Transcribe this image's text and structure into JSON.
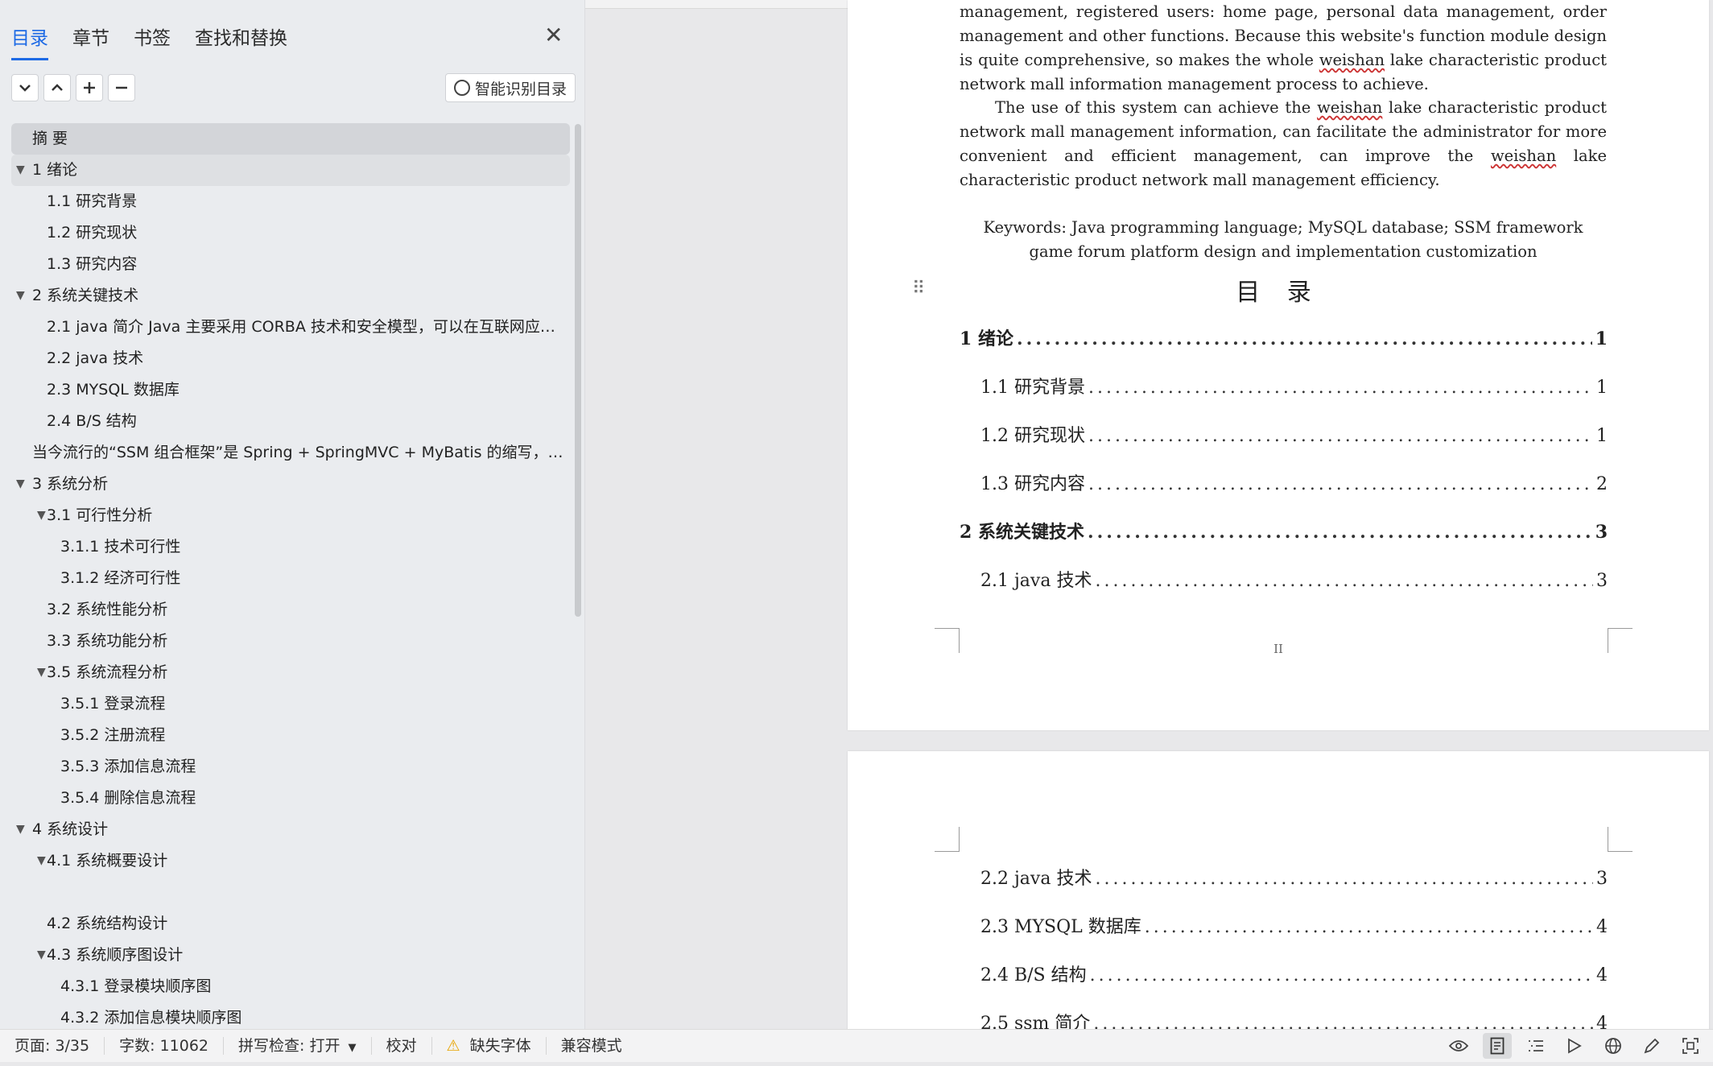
{
  "nav": {
    "tabs": [
      "目录",
      "章节",
      "书签",
      "查找和替换"
    ],
    "smart_button": "智能识别目录",
    "toolbar_icons": [
      "chevron-down-icon",
      "chevron-up-icon",
      "plus-icon",
      "minus-icon"
    ],
    "items": [
      {
        "text": "摘  要",
        "level": 0,
        "expand": false
      },
      {
        "text": "1  绪论",
        "level": 0,
        "expand": true
      },
      {
        "text": "1.1 研究背景",
        "level": 1,
        "expand": false
      },
      {
        "text": "1.2 研究现状",
        "level": 1,
        "expand": false
      },
      {
        "text": "1.3 研究内容",
        "level": 1,
        "expand": false
      },
      {
        "text": "2  系统关键技术",
        "level": 0,
        "expand": true
      },
      {
        "text": "2.1    java 简介     Java 主要采用 CORBA 技术和安全模型，可以在互联网应…",
        "level": 1,
        "expand": false
      },
      {
        "text": "2.2 java 技术",
        "level": 1,
        "expand": false
      },
      {
        "text": "2.3 MYSQL 数据库",
        "level": 1,
        "expand": false
      },
      {
        "text": "2.4 B/S 结构",
        "level": 1,
        "expand": false
      },
      {
        "text": "当今流行的“SSM 组合框架”是 Spring + SpringMVC + MyBatis 的缩写，受…",
        "level": 0,
        "expand": false
      },
      {
        "text": "3  系统分析",
        "level": 0,
        "expand": true
      },
      {
        "text": "3.1  可行性分析",
        "level": 1,
        "expand": true
      },
      {
        "text": "3.1.1  技术可行性",
        "level": 2,
        "expand": false
      },
      {
        "text": "3.1.2 经济可行性",
        "level": 2,
        "expand": false
      },
      {
        "text": "3.2  系统性能分析",
        "level": 1,
        "expand": false
      },
      {
        "text": "3.3  系统功能分析",
        "level": 1,
        "expand": false
      },
      {
        "text": "3.5 系统流程分析",
        "level": 1,
        "expand": true
      },
      {
        "text": "3.5.1 登录流程",
        "level": 2,
        "expand": false
      },
      {
        "text": "3.5.2 注册流程",
        "level": 2,
        "expand": false
      },
      {
        "text": "3.5.3 添加信息流程",
        "level": 2,
        "expand": false
      },
      {
        "text": "3.5.4 删除信息流程",
        "level": 2,
        "expand": false
      },
      {
        "text": "4    系统设计",
        "level": 0,
        "expand": true
      },
      {
        "text": "4.1 系统概要设计",
        "level": 1,
        "expand": true
      },
      {
        "text": "",
        "level": 1,
        "expand": false
      },
      {
        "text": "4.2 系统结构设计",
        "level": 1,
        "expand": false
      },
      {
        "text": "4.3 系统顺序图设计",
        "level": 1,
        "expand": true
      },
      {
        "text": "4.3.1 登录模块顺序图",
        "level": 2,
        "expand": false
      },
      {
        "text": "4.3.2 添加信息模块顺序图",
        "level": 2,
        "expand": false
      }
    ]
  },
  "doc": {
    "para1": [
      {
        "t": "management, registered users: home page, personal data management, order management and other functions. Because this website's function module design is quite comprehensive, so makes the whole "
      },
      {
        "t": "weishan",
        "sq": true
      },
      {
        "t": " lake characteristic product network mall information management process to achieve."
      }
    ],
    "para2": [
      {
        "t": "The use of this system can achieve the "
      },
      {
        "t": "weishan",
        "sq": true
      },
      {
        "t": " lake characteristic product network mall management information, can facilitate the administrator for more convenient and efficient management, can improve the "
      },
      {
        "t": "weishan",
        "sq": true
      },
      {
        "t": " lake characteristic product network mall management efficiency."
      }
    ],
    "keywords": "Keywords: Java programming language; MySQL database; SSM framework game forum platform design and implementation customization",
    "toc_title": "目 录",
    "page_number": "II",
    "toc_page1": [
      {
        "label": "1  绪论",
        "page": "1",
        "level": 1
      },
      {
        "label": "1.1 研究背景",
        "page": "1",
        "level": 2
      },
      {
        "label": "1.2 研究现状",
        "page": "1",
        "level": 2
      },
      {
        "label": "1.3 研究内容",
        "page": "2",
        "level": 2
      },
      {
        "label": "2  系统关键技术",
        "page": "3",
        "level": 1
      },
      {
        "label": "2.1 java 技术",
        "page": "3",
        "level": 2
      }
    ],
    "toc_page2": [
      {
        "label": "2.2 java 技术",
        "page": "3",
        "level": 2
      },
      {
        "label": "2.3 MYSQL 数据库",
        "page": "4",
        "level": 2
      },
      {
        "label": "2.4 B/S 结构",
        "page": "4",
        "level": 2
      },
      {
        "label": "2.5 ssm 简介",
        "page": "4",
        "level": 2
      }
    ]
  },
  "status": {
    "page": "页面: 3/35",
    "words": "字数: 11062",
    "spell": "拼写检查: 打开",
    "proof": "校对",
    "missing_font": "缺失字体",
    "compat": "兼容模式"
  },
  "status_icons": [
    "eye-icon",
    "page-view-icon",
    "outline-view-icon",
    "play-icon",
    "globe-icon",
    "pen-icon",
    "fit-window-icon"
  ]
}
